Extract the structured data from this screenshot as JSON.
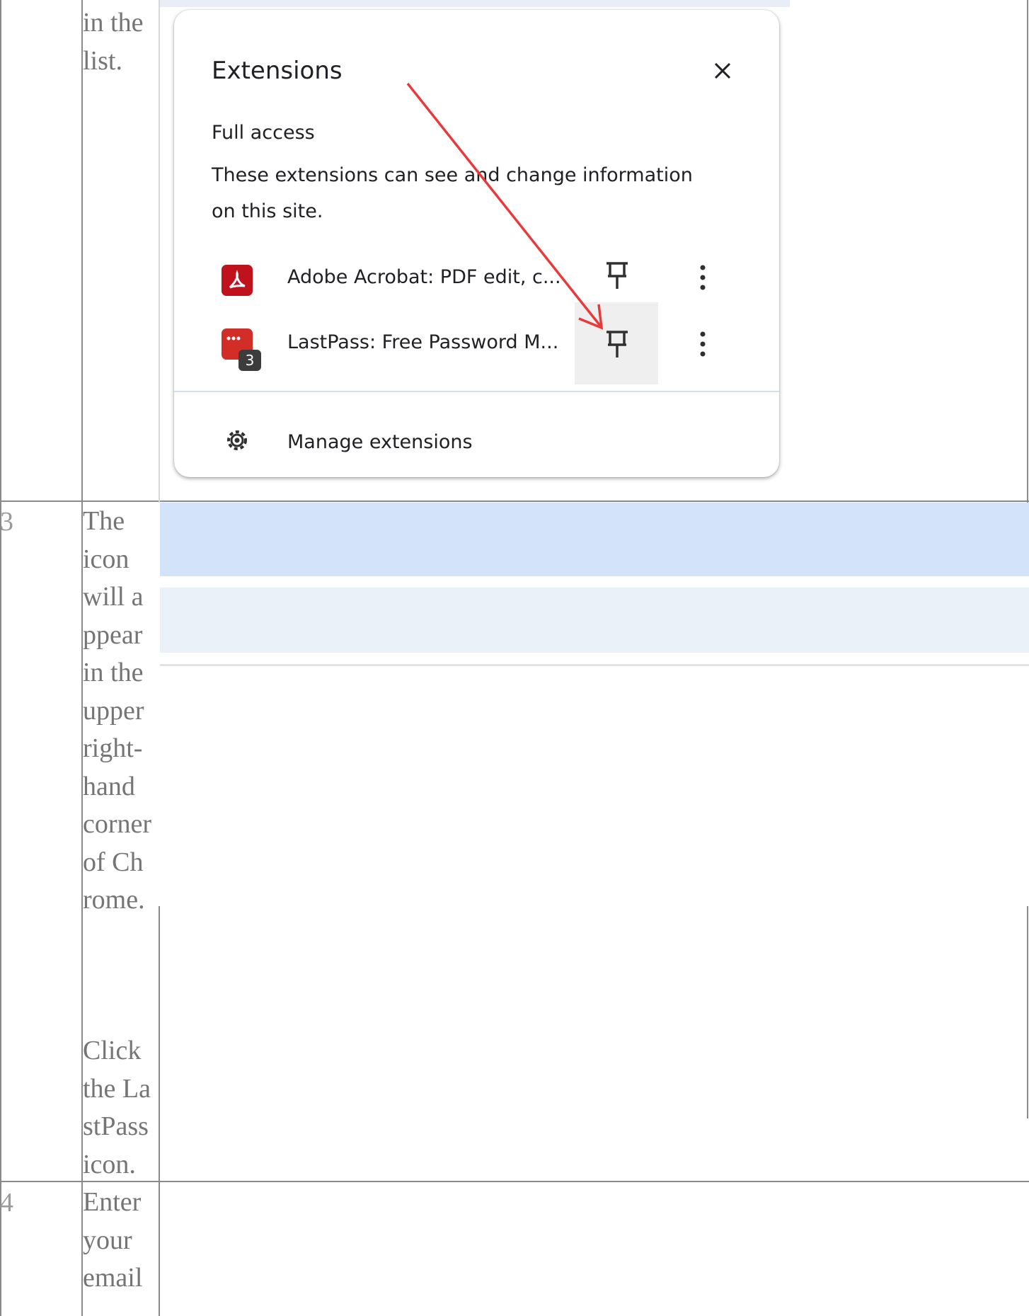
{
  "table": {
    "row2": {
      "text_lines": [
        "in the",
        "list."
      ]
    },
    "row3": {
      "number": "3",
      "text_lines_a": [
        "The",
        "icon",
        "will a",
        "ppear",
        "in the",
        "upper",
        "right-",
        "hand",
        "corner",
        "of Ch",
        "rome."
      ],
      "text_lines_b": [
        "Click",
        "the La",
        "stPass",
        "icon."
      ]
    },
    "row4": {
      "number": "4",
      "text_lines": [
        "Enter",
        "your",
        "email"
      ]
    }
  },
  "popup": {
    "title": "Extensions",
    "section_title": "Full access",
    "section_desc": "These extensions can see and change information on this site.",
    "extensions": [
      {
        "label": "Adobe Acrobat: PDF edit, c...",
        "icon": "adobe-acrobat-icon"
      },
      {
        "label": "LastPass: Free Password M...",
        "icon": "lastpass-icon",
        "badge": "3"
      }
    ],
    "manage_label": "Manage extensions"
  },
  "colors": {
    "annotation_arrow": "#e83a3a",
    "band_primary": "#d3e3f9",
    "band_secondary": "#ebf1f9"
  }
}
